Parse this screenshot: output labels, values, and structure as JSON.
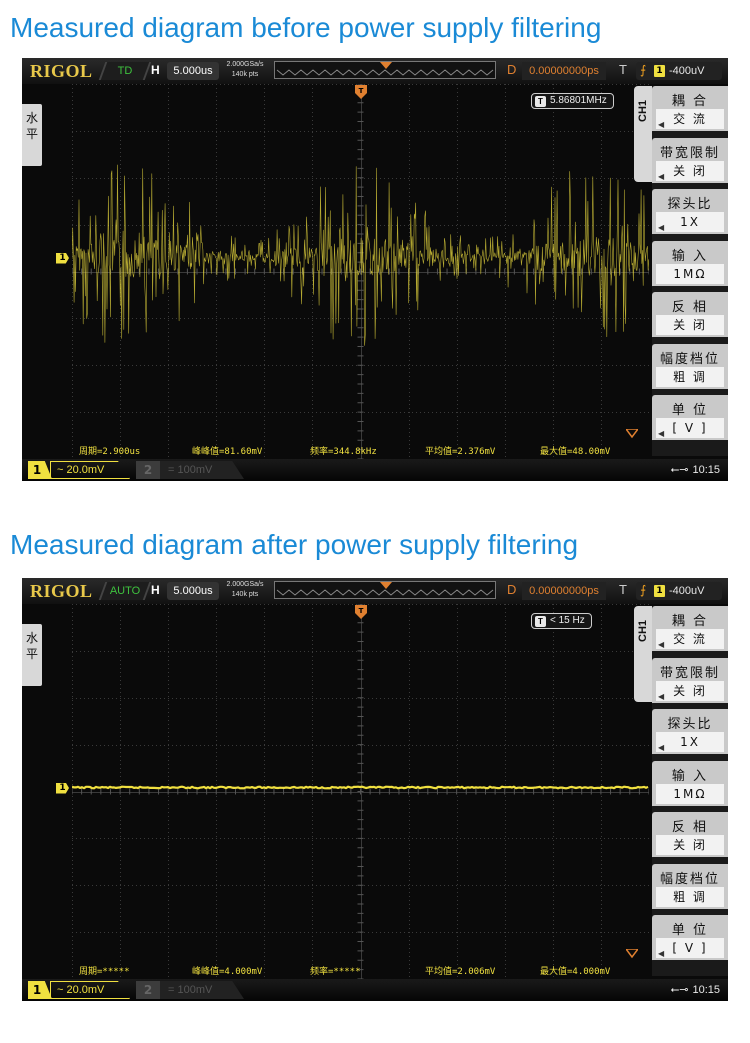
{
  "headings": {
    "before": "Measured diagram before power supply filtering",
    "after": "Measured diagram after power supply filtering"
  },
  "scopes": [
    {
      "logo": "RIGOL",
      "mode": "TD",
      "h_label": "H",
      "timebase": "5.000us",
      "sample_rate": "2.000GSa/s",
      "memory_depth": "140k pts",
      "d_label": "D",
      "delay": "0.00000000ps",
      "t_label": "T",
      "trigger_channel": "1",
      "trigger_level": "-400uV",
      "side_tab": "水平",
      "channel_tab": "CH1",
      "counter_label": "T",
      "counter": "5.86801MHz",
      "ground_marker": "1",
      "trace_style": "noisy",
      "menu": [
        {
          "label": "耦 合",
          "value": "交 流",
          "arrow": "◀"
        },
        {
          "label": "带宽限制",
          "value": "关 闭",
          "arrow": "◀"
        },
        {
          "label": "探头比",
          "value": "1X",
          "arrow": "◀"
        },
        {
          "label": "输 入",
          "value": "1MΩ",
          "arrow": ""
        },
        {
          "label": "反 相",
          "value": "关 闭",
          "arrow": ""
        },
        {
          "label": "幅度档位",
          "value": "粗 调",
          "arrow": ""
        },
        {
          "label": "单 位",
          "value": "[ V ]",
          "arrow": "◀"
        }
      ],
      "measurements": {
        "period": "周期=2.900us",
        "vpp": "峰峰值=81.60mV",
        "freq": "频率=344.8kHz",
        "avg": "平均值=2.376mV",
        "max": "最大值=48.00mV"
      },
      "ch1_number": "1",
      "ch1_scale": "~ 20.0mV",
      "ch2_number": "2",
      "ch2_scale": "= 100mV",
      "usb_icon": "⭠⊸",
      "time": "10:15"
    },
    {
      "logo": "RIGOL",
      "mode": "AUTO",
      "h_label": "H",
      "timebase": "5.000us",
      "sample_rate": "2.000GSa/s",
      "memory_depth": "140k pts",
      "d_label": "D",
      "delay": "0.00000000ps",
      "t_label": "T",
      "trigger_channel": "1",
      "trigger_level": "-400uV",
      "side_tab": "水平",
      "channel_tab": "CH1",
      "counter_label": "T",
      "counter": "< 15 Hz",
      "ground_marker": "1",
      "trace_style": "flat",
      "menu": [
        {
          "label": "耦 合",
          "value": "交 流",
          "arrow": "◀"
        },
        {
          "label": "带宽限制",
          "value": "关 闭",
          "arrow": "◀"
        },
        {
          "label": "探头比",
          "value": "1X",
          "arrow": "◀"
        },
        {
          "label": "输 入",
          "value": "1MΩ",
          "arrow": ""
        },
        {
          "label": "反 相",
          "value": "关 闭",
          "arrow": ""
        },
        {
          "label": "幅度档位",
          "value": "粗 调",
          "arrow": ""
        },
        {
          "label": "单 位",
          "value": "[ V ]",
          "arrow": "◀"
        }
      ],
      "measurements": {
        "period": "周期=*****",
        "vpp": "峰峰值=4.000mV",
        "freq": "频率=*****",
        "avg": "平均值=2.006mV",
        "max": "最大值=4.000mV"
      },
      "ch1_number": "1",
      "ch1_scale": "~ 20.0mV",
      "ch2_number": "2",
      "ch2_scale": "= 100mV",
      "usb_icon": "⭠⊸",
      "time": "10:15"
    }
  ],
  "colors": {
    "heading": "#1a8ad6",
    "trace": "#f0e040",
    "accent_orange": "#e08030"
  }
}
